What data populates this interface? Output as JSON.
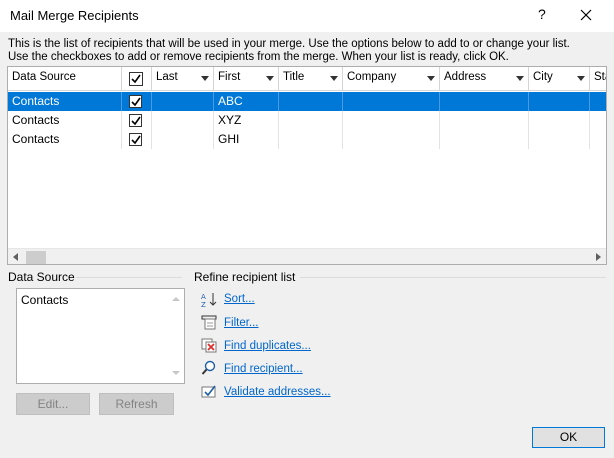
{
  "window": {
    "title": "Mail Merge Recipients",
    "help_glyph": "?"
  },
  "instructions": [
    "This is the list of recipients that will be used in your merge.  Use the options below to add to or change your list.",
    "Use the checkboxes to add or remove recipients from the merge.  When your list is ready, click OK."
  ],
  "grid": {
    "columns": [
      "Data Source",
      "",
      "Last",
      "First",
      "Title",
      "Company",
      "Address",
      "City",
      "Sta"
    ],
    "rows": [
      {
        "source": "Contacts",
        "checked": true,
        "last": "",
        "first": "ABC",
        "selected": true
      },
      {
        "source": "Contacts",
        "checked": true,
        "last": "",
        "first": "XYZ",
        "selected": false
      },
      {
        "source": "Contacts",
        "checked": true,
        "last": "",
        "first": "GHI",
        "selected": false
      }
    ]
  },
  "data_source": {
    "heading": "Data Source",
    "items": [
      "Contacts"
    ],
    "edit_label": "Edit...",
    "refresh_label": "Refresh"
  },
  "refine": {
    "heading": "Refine recipient list",
    "sort": "Sort...",
    "filter": "Filter...",
    "find_duplicates": "Find duplicates...",
    "find_recipient": "Find recipient...",
    "validate": "Validate addresses..."
  },
  "ok_label": "OK",
  "colors": {
    "selection": "#0078d7",
    "link": "#0066cc"
  }
}
